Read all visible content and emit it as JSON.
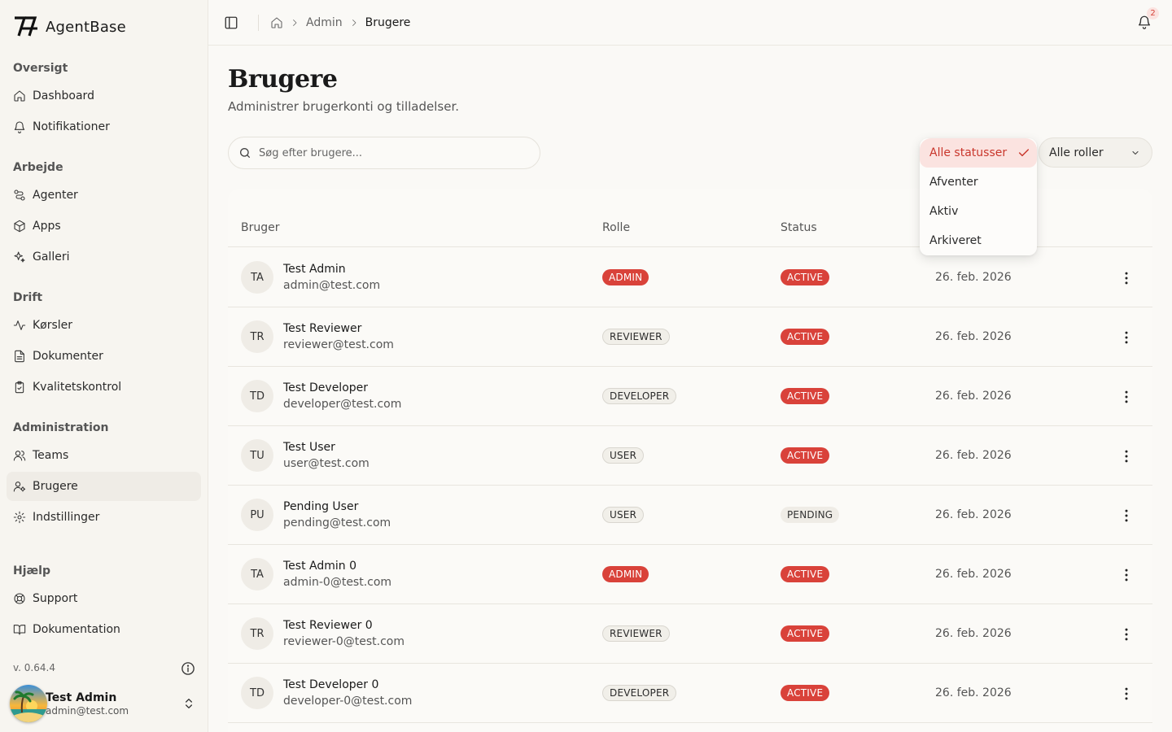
{
  "app": {
    "name": "AgentBase",
    "version": "v. 0.64.4"
  },
  "sidebar": {
    "sections": [
      {
        "title": "Oversigt",
        "items": [
          {
            "label": "Dashboard",
            "icon": "home-icon"
          },
          {
            "label": "Notifikationer",
            "icon": "bell-icon"
          }
        ]
      },
      {
        "title": "Arbejde",
        "items": [
          {
            "label": "Agenter",
            "icon": "route-icon"
          },
          {
            "label": "Apps",
            "icon": "box-icon"
          },
          {
            "label": "Galleri",
            "icon": "sparkles-icon"
          }
        ]
      },
      {
        "title": "Drift",
        "items": [
          {
            "label": "Kørsler",
            "icon": "activity-icon"
          },
          {
            "label": "Dokumenter",
            "icon": "file-text-icon"
          },
          {
            "label": "Kvalitetskontrol",
            "icon": "clipboard-check-icon"
          }
        ]
      },
      {
        "title": "Administration",
        "items": [
          {
            "label": "Teams",
            "icon": "users-icon"
          },
          {
            "label": "Brugere",
            "icon": "user-cog-icon",
            "active": true
          },
          {
            "label": "Indstillinger",
            "icon": "settings-icon"
          }
        ]
      },
      {
        "title": "Hjælp",
        "items": [
          {
            "label": "Support",
            "icon": "life-buoy-icon"
          },
          {
            "label": "Dokumentation",
            "icon": "book-open-icon"
          }
        ]
      }
    ],
    "user": {
      "name": "Test Admin",
      "email": "admin@test.com"
    }
  },
  "topbar": {
    "breadcrumb": [
      "Admin",
      "Brugere"
    ],
    "notifications_count": "2"
  },
  "page": {
    "title": "Brugere",
    "subtitle": "Administrer brugerkonti og tilladelser."
  },
  "filters": {
    "search_placeholder": "Søg efter brugere...",
    "status_selected": "Alle statusser",
    "status_options": [
      "Alle statusser",
      "Afventer",
      "Aktiv",
      "Arkiveret"
    ],
    "role_selected": "Alle roller"
  },
  "table": {
    "columns": [
      "Bruger",
      "Rolle",
      "Status"
    ],
    "rows": [
      {
        "initials": "TA",
        "name": "Test Admin",
        "email": "admin@test.com",
        "role": "ADMIN",
        "status": "ACTIVE",
        "date": "26. feb. 2026"
      },
      {
        "initials": "TR",
        "name": "Test Reviewer",
        "email": "reviewer@test.com",
        "role": "REVIEWER",
        "status": "ACTIVE",
        "date": "26. feb. 2026"
      },
      {
        "initials": "TD",
        "name": "Test Developer",
        "email": "developer@test.com",
        "role": "DEVELOPER",
        "status": "ACTIVE",
        "date": "26. feb. 2026"
      },
      {
        "initials": "TU",
        "name": "Test User",
        "email": "user@test.com",
        "role": "USER",
        "status": "ACTIVE",
        "date": "26. feb. 2026"
      },
      {
        "initials": "PU",
        "name": "Pending User",
        "email": "pending@test.com",
        "role": "USER",
        "status": "PENDING",
        "date": "26. feb. 2026"
      },
      {
        "initials": "TA",
        "name": "Test Admin 0",
        "email": "admin-0@test.com",
        "role": "ADMIN",
        "status": "ACTIVE",
        "date": "26. feb. 2026"
      },
      {
        "initials": "TR",
        "name": "Test Reviewer 0",
        "email": "reviewer-0@test.com",
        "role": "REVIEWER",
        "status": "ACTIVE",
        "date": "26. feb. 2026"
      },
      {
        "initials": "TD",
        "name": "Test Developer 0",
        "email": "developer-0@test.com",
        "role": "DEVELOPER",
        "status": "ACTIVE",
        "date": "26. feb. 2026"
      }
    ]
  },
  "colors": {
    "accent_red": "#d9423a",
    "selected_bg": "#fbe3e0",
    "background": "#faf9f6"
  }
}
